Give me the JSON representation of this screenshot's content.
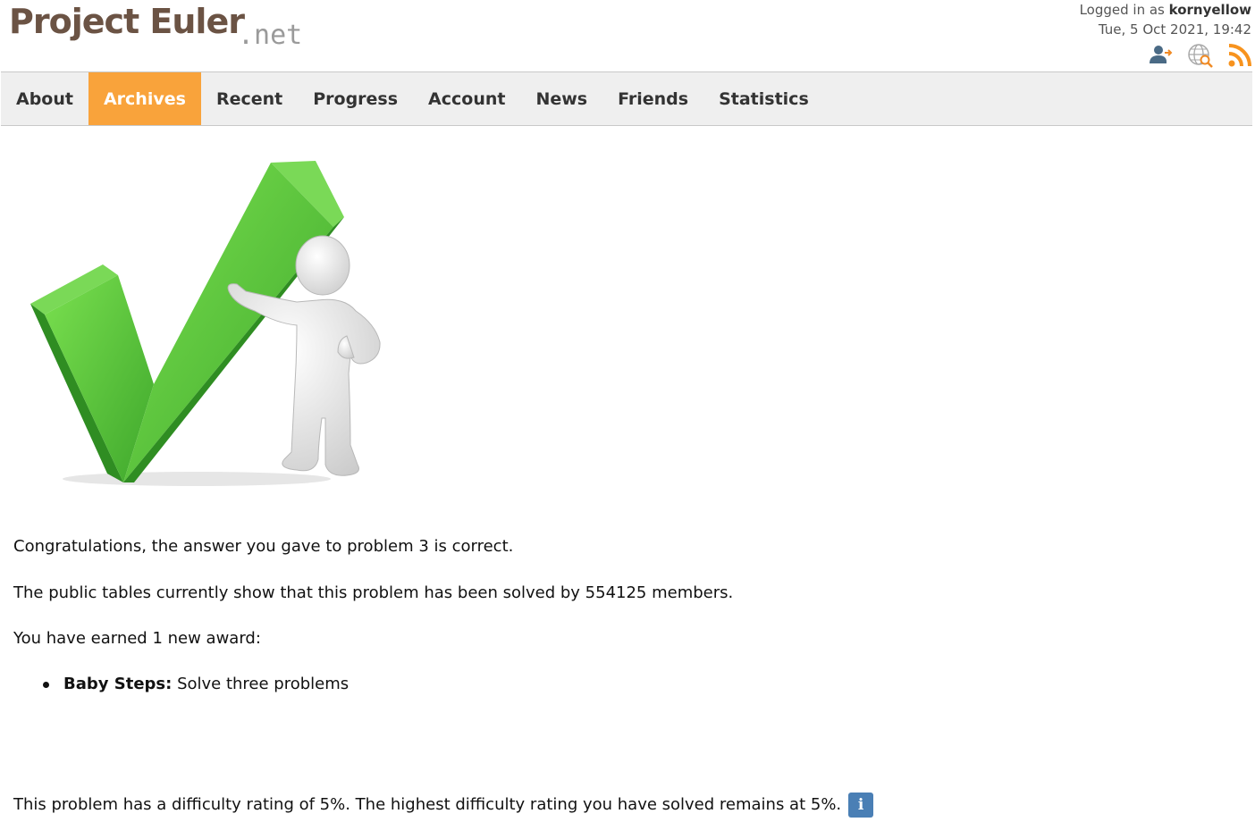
{
  "logo": {
    "main": "Project Euler",
    "suffix": ".net"
  },
  "header": {
    "logged_in_prefix": "Logged in as",
    "username": "kornyellow",
    "datetime": "Tue, 5 Oct 2021, 19:42",
    "icons": [
      "user-account-icon",
      "globe-search-icon",
      "rss-feed-icon"
    ]
  },
  "nav": {
    "items": [
      {
        "label": "About",
        "active": false
      },
      {
        "label": "Archives",
        "active": true
      },
      {
        "label": "Recent",
        "active": false
      },
      {
        "label": "Progress",
        "active": false
      },
      {
        "label": "Account",
        "active": false
      },
      {
        "label": "News",
        "active": false
      },
      {
        "label": "Friends",
        "active": false
      },
      {
        "label": "Statistics",
        "active": false
      }
    ],
    "active_color": "#f9a33b"
  },
  "content": {
    "congrats": "Congratulations, the answer you gave to problem 3 is correct.",
    "solved_by": "The public tables currently show that this problem has been solved by 554125 members.",
    "award_intro": "You have earned 1 new award:",
    "awards": [
      {
        "name": "Baby Steps:",
        "description": "Solve three problems"
      }
    ],
    "difficulty": "This problem has a difficulty rating of 5%. The highest difficulty rating you have solved remains at 5%.",
    "info_glyph": "i"
  },
  "colors": {
    "brand_brown": "#6b5344",
    "checkmark_green": "#4fbf3a",
    "info_blue": "#4a7fb5"
  }
}
